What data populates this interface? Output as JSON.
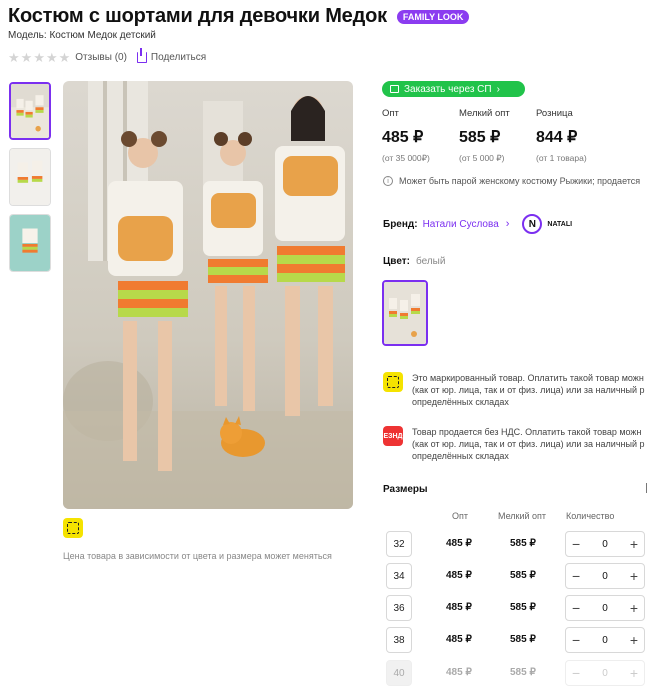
{
  "product": {
    "title": "Костюм с шортами для девочки Медок",
    "badge": "FAMILY LOOK",
    "model": "Модель: Костюм Медок детский",
    "reviews": "Отзывы (0)",
    "share": "Поделиться",
    "rating": 0
  },
  "order_button": "Заказать через СП",
  "prices": [
    {
      "label": "Опт",
      "value": "485 ₽",
      "min": "(от 35 000₽)"
    },
    {
      "label": "Мелкий опт",
      "value": "585 ₽",
      "min": "(от 5 000 ₽)"
    },
    {
      "label": "Розница",
      "value": "844 ₽",
      "min": "(от 1 товара)"
    }
  ],
  "info": "Может быть парой женскому костюму Рыжики; продается",
  "brand": {
    "label": "Бренд:",
    "name": "Натали Суслова",
    "logo_letter": "N",
    "logo_text": "NATALI"
  },
  "color": {
    "label": "Цвет:",
    "value": "белый"
  },
  "notices": {
    "marking": [
      "Это маркированный товар. Оплатить такой товар можн",
      "(как от юр. лица, так и от физ. лица) или за наличный р",
      "определённых складах"
    ],
    "nds_icon": [
      "БЕЗ",
      "НДС"
    ],
    "nds": [
      "Товар продается без НДС. Оплатить такой товар можн",
      "(как от юр. лица, так и от физ. лица) или за наличный р",
      "определённых складах"
    ]
  },
  "price_note": "Цена товара в зависимости от цвета и размера может меняться",
  "sizes": {
    "title": "Размеры",
    "headers": {
      "opt": "Опт",
      "small": "Мелкий опт",
      "qty": "Количество"
    },
    "rows": [
      {
        "size": "32",
        "opt": "485 ₽",
        "small": "585 ₽",
        "qty": "0"
      },
      {
        "size": "34",
        "opt": "485 ₽",
        "small": "585 ₽",
        "qty": "0"
      },
      {
        "size": "36",
        "opt": "485 ₽",
        "small": "585 ₽",
        "qty": "0"
      },
      {
        "size": "38",
        "opt": "485 ₽",
        "small": "585 ₽",
        "qty": "0"
      },
      {
        "size": "40",
        "opt": "485 ₽",
        "small": "585 ₽",
        "qty": "0"
      }
    ],
    "minus": "−",
    "plus": "+"
  },
  "colors": {
    "accent": "#7b2ff0",
    "green": "#21c34a",
    "marking": "#f5e300",
    "nds": "#e33333"
  },
  "icons": {
    "share": "share-icon",
    "info": "info-icon",
    "cart": "cart-icon",
    "chevron": "chevron-right-icon"
  }
}
